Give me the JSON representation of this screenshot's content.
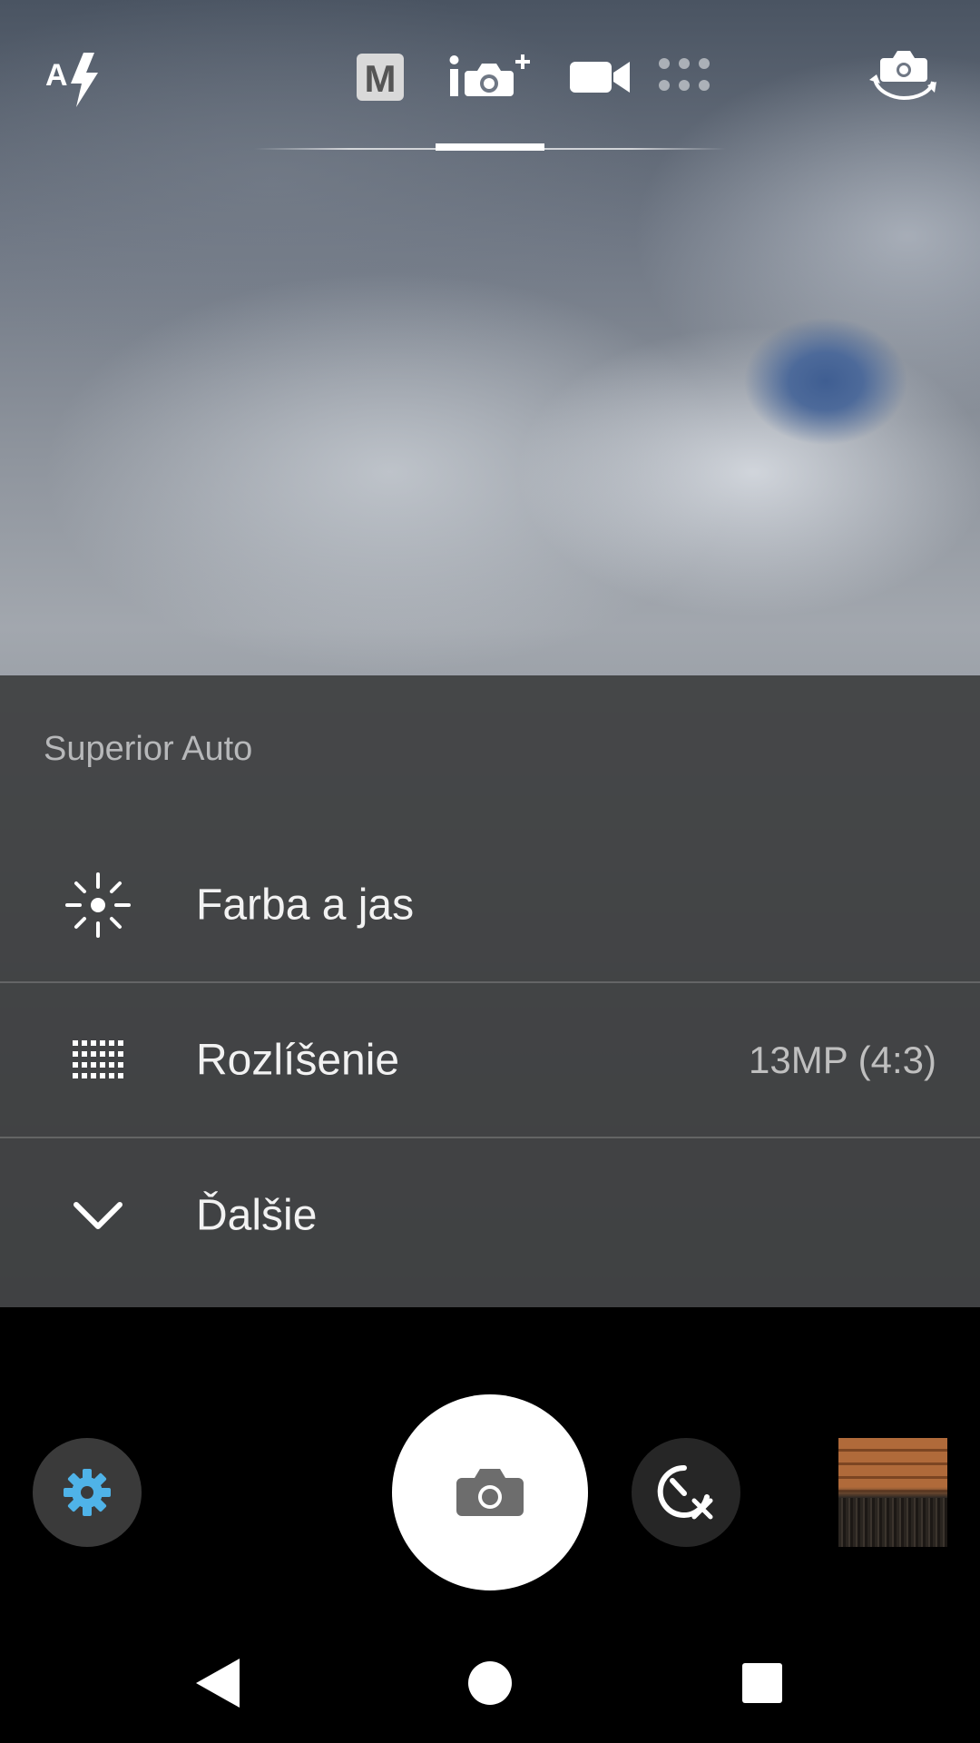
{
  "top_bar": {
    "flash_icon": "flash-auto-icon",
    "modes": [
      {
        "icon": "manual-mode-icon",
        "label": "M"
      },
      {
        "icon": "superior-auto-icon",
        "active": true
      },
      {
        "icon": "video-mode-icon"
      },
      {
        "icon": "more-apps-icon"
      }
    ],
    "switch_camera_icon": "switch-camera-icon"
  },
  "settings_panel": {
    "title": "Superior Auto",
    "rows": [
      {
        "icon": "brightness-icon",
        "label": "Farba a jas",
        "value": ""
      },
      {
        "icon": "resolution-grid-icon",
        "label": "Rozlíšenie",
        "value": "13MP (4:3)"
      },
      {
        "icon": "chevron-down-icon",
        "label": "Ďalšie",
        "value": ""
      }
    ]
  },
  "controls": {
    "settings_icon": "gear-icon",
    "shutter_icon": "camera-icon",
    "timer_icon": "self-timer-off-icon",
    "thumbnail": "last-photo-thumbnail"
  },
  "colors": {
    "gear_accent": "#4fb3e8",
    "sheet_bg": "#3e3f40"
  },
  "nav_bar": {
    "back_icon": "back-icon",
    "home_icon": "home-icon",
    "recents_icon": "recents-icon"
  }
}
